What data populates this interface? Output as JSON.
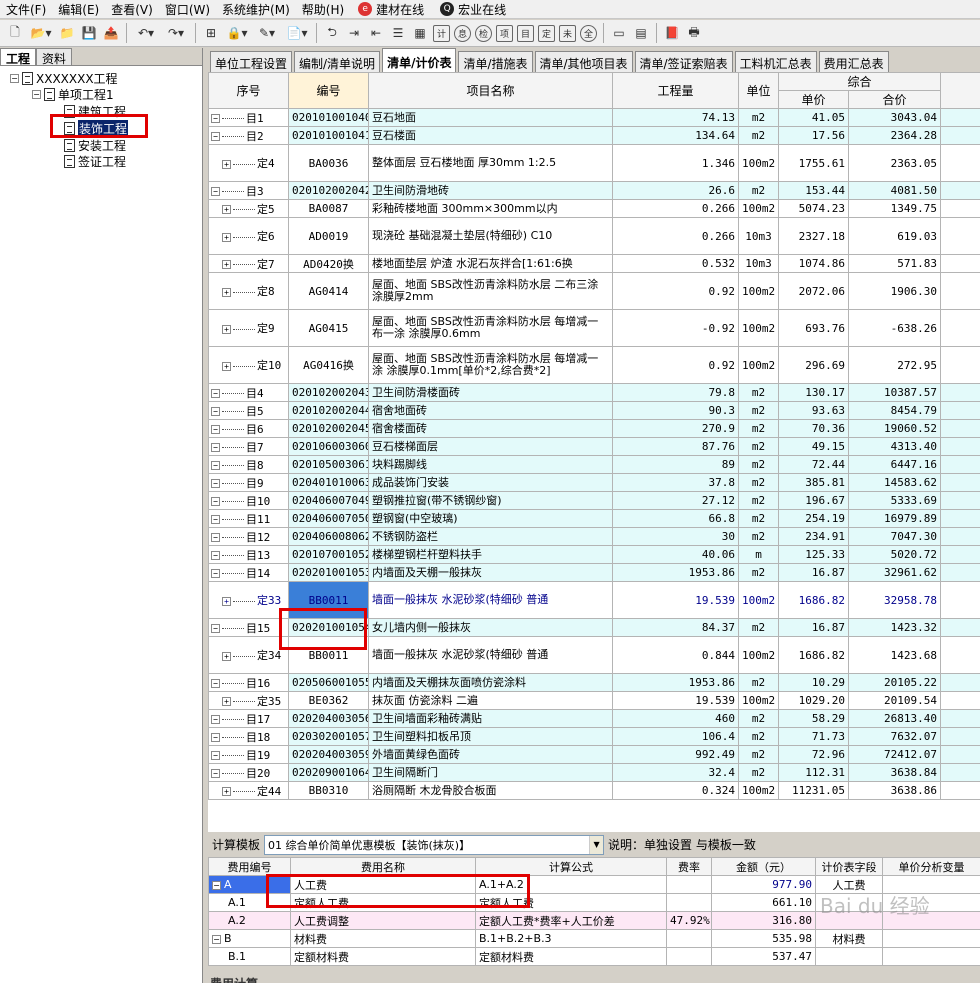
{
  "menu": [
    {
      "label": "文件(F)"
    },
    {
      "label": "编辑(E)"
    },
    {
      "label": "查看(V)"
    },
    {
      "label": "窗口(W)"
    },
    {
      "label": "系统维护(M)"
    },
    {
      "label": "帮助(H)"
    }
  ],
  "menu_links": [
    {
      "label": "建材在线",
      "icon": "ie-icon"
    },
    {
      "label": "宏业在线",
      "icon": "qq-icon"
    }
  ],
  "toolbar_letters": [
    "计",
    "息",
    "检",
    "项",
    "目",
    "定",
    "未",
    "全"
  ],
  "left": {
    "tabs": [
      "工程",
      "资料"
    ],
    "tree": {
      "root": "XXXXXXX工程",
      "sub": "单项工程1",
      "items": [
        "建筑工程",
        "装饰工程",
        "安装工程",
        "签证工程"
      ]
    }
  },
  "tabs": [
    "单位工程设置",
    "编制/清单说明",
    "清单/计价表",
    "清单/措施表",
    "清单/其他项目表",
    "清单/签证索赔表",
    "工料机汇总表",
    "费用汇总表"
  ],
  "active_tab": 2,
  "grid": {
    "headers": {
      "seq": "序号",
      "code": "编号",
      "name": "项目名称",
      "qty": "工程量",
      "unit": "单位",
      "combo": "综合",
      "price": "单价",
      "total": "合价"
    },
    "rows": [
      {
        "t": "mu",
        "seq": "目1",
        "code": "020101001040",
        "name": "豆石地面",
        "qty": "74.13",
        "unit": "m2",
        "price": "41.05",
        "total": "3043.04",
        "h": 1
      },
      {
        "t": "mu",
        "seq": "目2",
        "code": "020101001041",
        "name": "豆石楼面",
        "qty": "134.64",
        "unit": "m2",
        "price": "17.56",
        "total": "2364.28",
        "h": 1
      },
      {
        "t": "ding",
        "seq": "定4",
        "code": "BA0036",
        "name": "整体面层 豆石楼地面 厚30mm 1:2.5",
        "qty": "1.346",
        "unit": "100m2",
        "price": "1755.61",
        "total": "2363.05",
        "h": 2
      },
      {
        "t": "mu",
        "seq": "目3",
        "code": "020102002042",
        "name": "卫生间防滑地砖",
        "qty": "26.6",
        "unit": "m2",
        "price": "153.44",
        "total": "4081.50",
        "h": 1
      },
      {
        "t": "ding",
        "seq": "定5",
        "code": "BA0087",
        "name": "彩釉砖楼地面 300mm×300mm以内",
        "qty": "0.266",
        "unit": "100m2",
        "price": "5074.23",
        "total": "1349.75",
        "h": 1
      },
      {
        "t": "ding",
        "seq": "定6",
        "code": "AD0019",
        "name": "现浇砼 基础混凝土垫层(特细砂) C10",
        "qty": "0.266",
        "unit": "10m3",
        "price": "2327.18",
        "total": "619.03",
        "h": 2
      },
      {
        "t": "ding",
        "seq": "定7",
        "code": "AD0420换",
        "name": "楼地面垫层 炉渣 水泥石灰拌合[1:61:6换",
        "qty": "0.532",
        "unit": "10m3",
        "price": "1074.86",
        "total": "571.83",
        "h": 1
      },
      {
        "t": "ding",
        "seq": "定8",
        "code": "AG0414",
        "name": "屋面、地面 SBS改性沥青涂料防水层 二布三涂 涂膜厚2mm",
        "qty": "0.92",
        "unit": "100m2",
        "price": "2072.06",
        "total": "1906.30",
        "h": 2
      },
      {
        "t": "ding",
        "seq": "定9",
        "code": "AG0415",
        "name": "屋面、地面 SBS改性沥青涂料防水层 每增减一布一涂 涂膜厚0.6mm",
        "qty": "-0.92",
        "unit": "100m2",
        "price": "693.76",
        "total": "-638.26",
        "h": 2
      },
      {
        "t": "ding",
        "seq": "定10",
        "code": "AG0416换",
        "name": "屋面、地面 SBS改性沥青涂料防水层 每增减一涂 涂膜厚0.1mm[单价*2,综合费*2]",
        "qty": "0.92",
        "unit": "100m2",
        "price": "296.69",
        "total": "272.95",
        "h": 2
      },
      {
        "t": "mu",
        "seq": "目4",
        "code": "020102002043",
        "name": "卫生间防滑楼面砖",
        "qty": "79.8",
        "unit": "m2",
        "price": "130.17",
        "total": "10387.57",
        "h": 1
      },
      {
        "t": "mu",
        "seq": "目5",
        "code": "020102002044",
        "name": "宿舍地面砖",
        "qty": "90.3",
        "unit": "m2",
        "price": "93.63",
        "total": "8454.79",
        "h": 1
      },
      {
        "t": "mu",
        "seq": "目6",
        "code": "020102002045",
        "name": "宿舍楼面砖",
        "qty": "270.9",
        "unit": "m2",
        "price": "70.36",
        "total": "19060.52",
        "h": 1
      },
      {
        "t": "mu",
        "seq": "目7",
        "code": "020106003060",
        "name": "豆石楼梯面层",
        "qty": "87.76",
        "unit": "m2",
        "price": "49.15",
        "total": "4313.40",
        "h": 1
      },
      {
        "t": "mu",
        "seq": "目8",
        "code": "020105003061",
        "name": "块料踢脚线",
        "qty": "89",
        "unit": "m2",
        "price": "72.44",
        "total": "6447.16",
        "h": 1
      },
      {
        "t": "mu",
        "seq": "目9",
        "code": "020401010063",
        "name": "成品装饰门安装",
        "qty": "37.8",
        "unit": "m2",
        "price": "385.81",
        "total": "14583.62",
        "h": 1
      },
      {
        "t": "mu",
        "seq": "目10",
        "code": "020406007049",
        "name": "塑钢推拉窗(带不锈钢纱窗)",
        "qty": "27.12",
        "unit": "m2",
        "price": "196.67",
        "total": "5333.69",
        "h": 1
      },
      {
        "t": "mu",
        "seq": "目11",
        "code": "020406007050",
        "name": "塑钢窗(中空玻璃)",
        "qty": "66.8",
        "unit": "m2",
        "price": "254.19",
        "total": "16979.89",
        "h": 1
      },
      {
        "t": "mu",
        "seq": "目12",
        "code": "020406008062",
        "name": "不锈钢防盗栏",
        "qty": "30",
        "unit": "m2",
        "price": "234.91",
        "total": "7047.30",
        "h": 1
      },
      {
        "t": "mu",
        "seq": "目13",
        "code": "020107001052",
        "name": "楼梯塑钢栏杆塑料扶手",
        "qty": "40.06",
        "unit": "m",
        "price": "125.33",
        "total": "5020.72",
        "h": 1
      },
      {
        "t": "mu",
        "seq": "目14",
        "code": "020201001053",
        "name": "内墙面及天棚一般抹灰",
        "qty": "1953.86",
        "unit": "m2",
        "price": "16.87",
        "total": "32961.62",
        "h": 1
      },
      {
        "t": "ding",
        "seq": "定33",
        "code": "BB0011",
        "name": "墙面一般抹灰 水泥砂浆(特细砂 普通",
        "qty": "19.539",
        "unit": "100m2",
        "price": "1686.82",
        "total": "32958.78",
        "h": 2,
        "hl": true
      },
      {
        "t": "mu",
        "seq": "目15",
        "code": "020201001054",
        "name": "女儿墙内侧一般抹灰",
        "qty": "84.37",
        "unit": "m2",
        "price": "16.87",
        "total": "1423.32",
        "h": 1
      },
      {
        "t": "ding",
        "seq": "定34",
        "code": "BB0011",
        "name": "墙面一般抹灰 水泥砂浆(特细砂 普通",
        "qty": "0.844",
        "unit": "100m2",
        "price": "1686.82",
        "total": "1423.68",
        "h": 2
      },
      {
        "t": "mu",
        "seq": "目16",
        "code": "020506001055",
        "name": "内墙面及天棚抹灰面喷仿瓷涂料",
        "qty": "1953.86",
        "unit": "m2",
        "price": "10.29",
        "total": "20105.22",
        "h": 1
      },
      {
        "t": "ding",
        "seq": "定35",
        "code": "BE0362",
        "name": "抹灰面 仿瓷涂料 二遍",
        "qty": "19.539",
        "unit": "100m2",
        "price": "1029.20",
        "total": "20109.54",
        "h": 1
      },
      {
        "t": "mu",
        "seq": "目17",
        "code": "020204003056",
        "name": "卫生间墙面彩釉砖满贴",
        "qty": "460",
        "unit": "m2",
        "price": "58.29",
        "total": "26813.40",
        "h": 1
      },
      {
        "t": "mu",
        "seq": "目18",
        "code": "020302001057",
        "name": "卫生间塑料扣板吊顶",
        "qty": "106.4",
        "unit": "m2",
        "price": "71.73",
        "total": "7632.07",
        "h": 1
      },
      {
        "t": "mu",
        "seq": "目19",
        "code": "020204003059",
        "name": "外墙面黄绿色面砖",
        "qty": "992.49",
        "unit": "m2",
        "price": "72.96",
        "total": "72412.07",
        "h": 1
      },
      {
        "t": "mu",
        "seq": "目20",
        "code": "020209001064",
        "name": "卫生间隔断门",
        "qty": "32.4",
        "unit": "m2",
        "price": "112.31",
        "total": "3638.84",
        "h": 1
      },
      {
        "t": "ding",
        "seq": "定44",
        "code": "BB0310",
        "name": "浴厕隔断 木龙骨胶合板面",
        "qty": "0.324",
        "unit": "100m2",
        "price": "11231.05",
        "total": "3638.86",
        "h": 1
      }
    ]
  },
  "calc": {
    "label": "计算模板",
    "template": "01 综合单价简单优惠模板【装饰(抹灰)】",
    "note": "说明：单独设置 与模板一致",
    "headers": [
      "费用编号",
      "费用名称",
      "计算公式",
      "费率",
      "金额（元）",
      "计价表字段",
      "单价分析变量"
    ],
    "rows": [
      {
        "code": "A",
        "name": "人工费",
        "formula": "A.1+A.2",
        "rate": "",
        "amount": "977.90",
        "field": "人工费",
        "var": ""
      },
      {
        "code": "A.1",
        "name": "定额人工费",
        "formula": "定额人工费",
        "rate": "",
        "amount": "661.10",
        "field": "",
        "var": ""
      },
      {
        "code": "A.2",
        "name": "人工费调整",
        "formula": "定额人工费*费率+人工价差",
        "rate": "47.92%",
        "amount": "316.80",
        "field": "",
        "var": ""
      },
      {
        "code": "B",
        "name": "材料费",
        "formula": "B.1+B.2+B.3",
        "rate": "",
        "amount": "535.98",
        "field": "材料费",
        "var": ""
      },
      {
        "code": "B.1",
        "name": "定额材料费",
        "formula": "定额材料费",
        "rate": "",
        "amount": "537.47",
        "field": "",
        "var": ""
      }
    ],
    "bottom_tab": "费用计算"
  },
  "watermark": "Bai du 经验"
}
